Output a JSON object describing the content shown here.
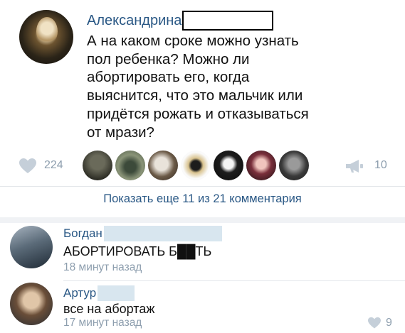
{
  "post": {
    "author": "Александрина",
    "text": "А на каком сроке можно узнать\nпол ребенка? Можно ли\nабортировать его, когда\nвыяснится, что это мальчик или\nпридётся рожать и отказываться\nот мрази?",
    "likes": "224",
    "shares": "10"
  },
  "show_more": "Показать еще 11 из 21 комментария",
  "comments": [
    {
      "author": "Богдан",
      "text": "АБОРТИРОВАТЬ Б██ТЬ",
      "time": "18 минут назад",
      "likes": ""
    },
    {
      "author": "Артур",
      "text": "все на абортаж",
      "time": "17 минут назад",
      "likes": "9"
    }
  ],
  "colors": {
    "link": "#2a5885",
    "muted": "#8d9eae",
    "text": "#111111"
  },
  "icons": {
    "like": "heart-icon",
    "share": "megaphone-icon"
  }
}
